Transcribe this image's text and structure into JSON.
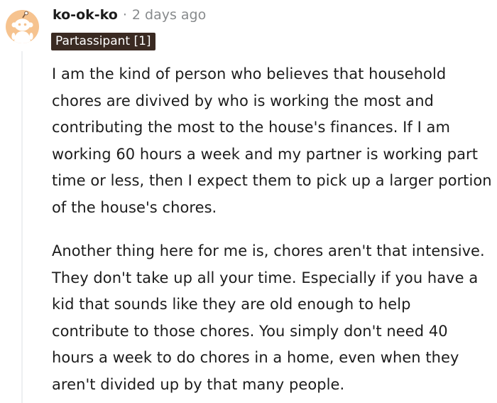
{
  "comment": {
    "username": "ko-ok-ko",
    "separator": "·",
    "timestamp": "2 days ago",
    "flair": "Partassipant [1]",
    "avatar_icon": "snoo-avatar-icon",
    "paragraphs": [
      "I am the kind of person who believes that household chores are divived by who is working the most and contributing the most to the house's finances. If I am working 60 hours a week and my partner is working part time or less, then I expect them to pick up a larger portion of the house's chores.",
      "Another thing here for me is, chores aren't that intensive. They don't take up all your time. Especially if you have a kid that sounds like they are old enough to help contribute to those chores. You simply don't need 40 hours a week to do chores in a home, even when they aren't divided up by that many people."
    ]
  },
  "colors": {
    "avatar_bg": "#f6c38f",
    "flair_bg": "#3a2a22",
    "meta_text": "#878a8c",
    "thread_line": "#edeff1"
  }
}
